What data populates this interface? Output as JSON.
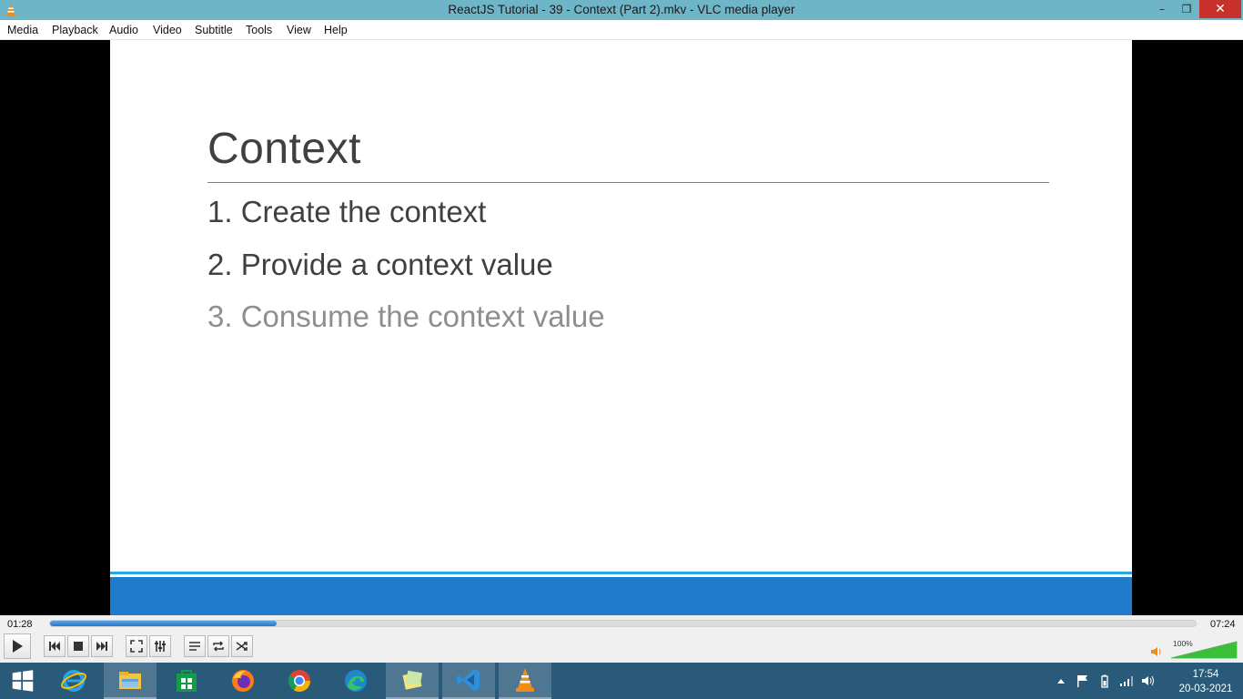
{
  "window": {
    "title": "ReactJS Tutorial - 39 - Context (Part 2).mkv - VLC media player",
    "minimize": "–",
    "maximize": "❐",
    "close": "✕"
  },
  "menu": [
    "Media",
    "Playback",
    "Audio",
    "Video",
    "Subtitle",
    "Tools",
    "View",
    "Help"
  ],
  "slide": {
    "title": "Context",
    "items": [
      "1. Create the context",
      "2. Provide a context value",
      "3. Consume the context value"
    ]
  },
  "player": {
    "elapsed": "01:28",
    "total": "07:24",
    "progress_fraction": 0.198,
    "volume": "100%",
    "volume_fraction": 1.0
  },
  "taskbar": {
    "apps": [
      "windows-start-icon",
      "internet-explorer-icon",
      "file-explorer-icon",
      "store-icon",
      "firefox-icon",
      "chrome-icon",
      "edge-icon",
      "sticky-notes-icon",
      "vscode-icon",
      "vlc-icon"
    ],
    "time": "17:54",
    "date": "20-03-2021"
  },
  "colors": {
    "titlebar": "#6fb5c8",
    "close": "#c7302b",
    "seek_fill": "#2a77c9",
    "slide_band": "#1f7bcb",
    "taskbar": "#2a5a7a"
  }
}
